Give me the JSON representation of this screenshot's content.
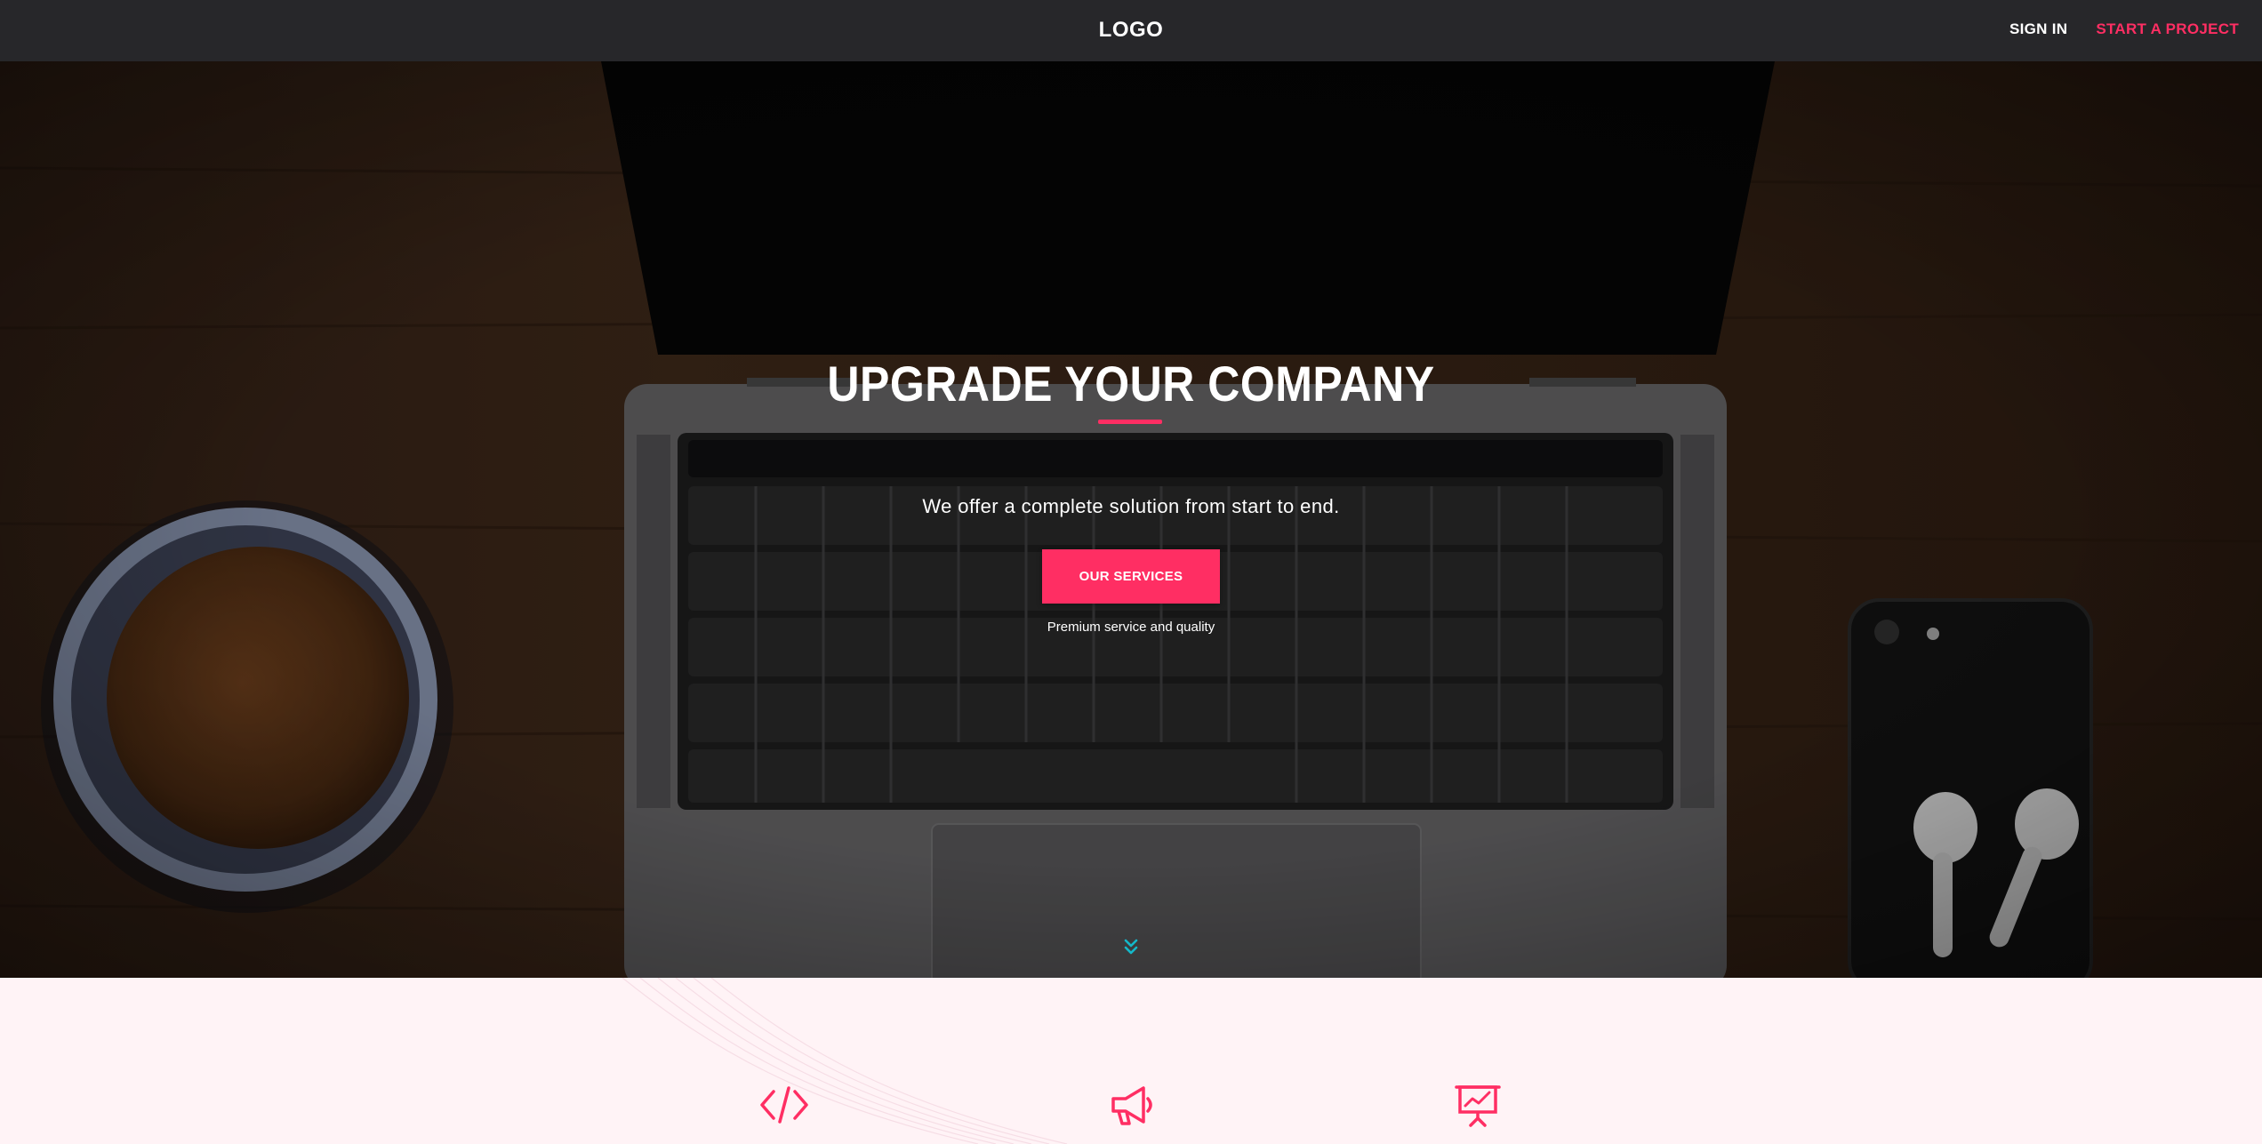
{
  "nav": {
    "logo": "LOGO",
    "sign_in": "SIGN IN",
    "start_project": "START A PROJECT"
  },
  "hero": {
    "title": "UPGRADE YOUR COMPANY",
    "subtitle": "We offer a complete solution from start to end.",
    "button": "OUR SERVICES",
    "tagline": "Premium service and quality",
    "scroll_icon": "double-chevron-down-icon"
  },
  "services": {
    "icons": [
      "code-icon",
      "megaphone-icon",
      "presentation-chart-icon"
    ]
  },
  "colors": {
    "accent": "#ff2e63",
    "nav_bg": "#27272a",
    "section_bg": "#fff3f6"
  }
}
